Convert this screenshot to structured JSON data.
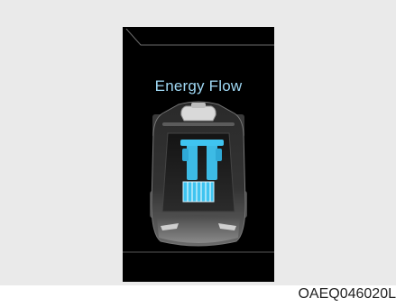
{
  "screen": {
    "title": "Energy Flow",
    "accent_color": "#3fc4f0",
    "flow_state": "battery-to-wheels"
  },
  "image_code": "OAEQ046020L"
}
